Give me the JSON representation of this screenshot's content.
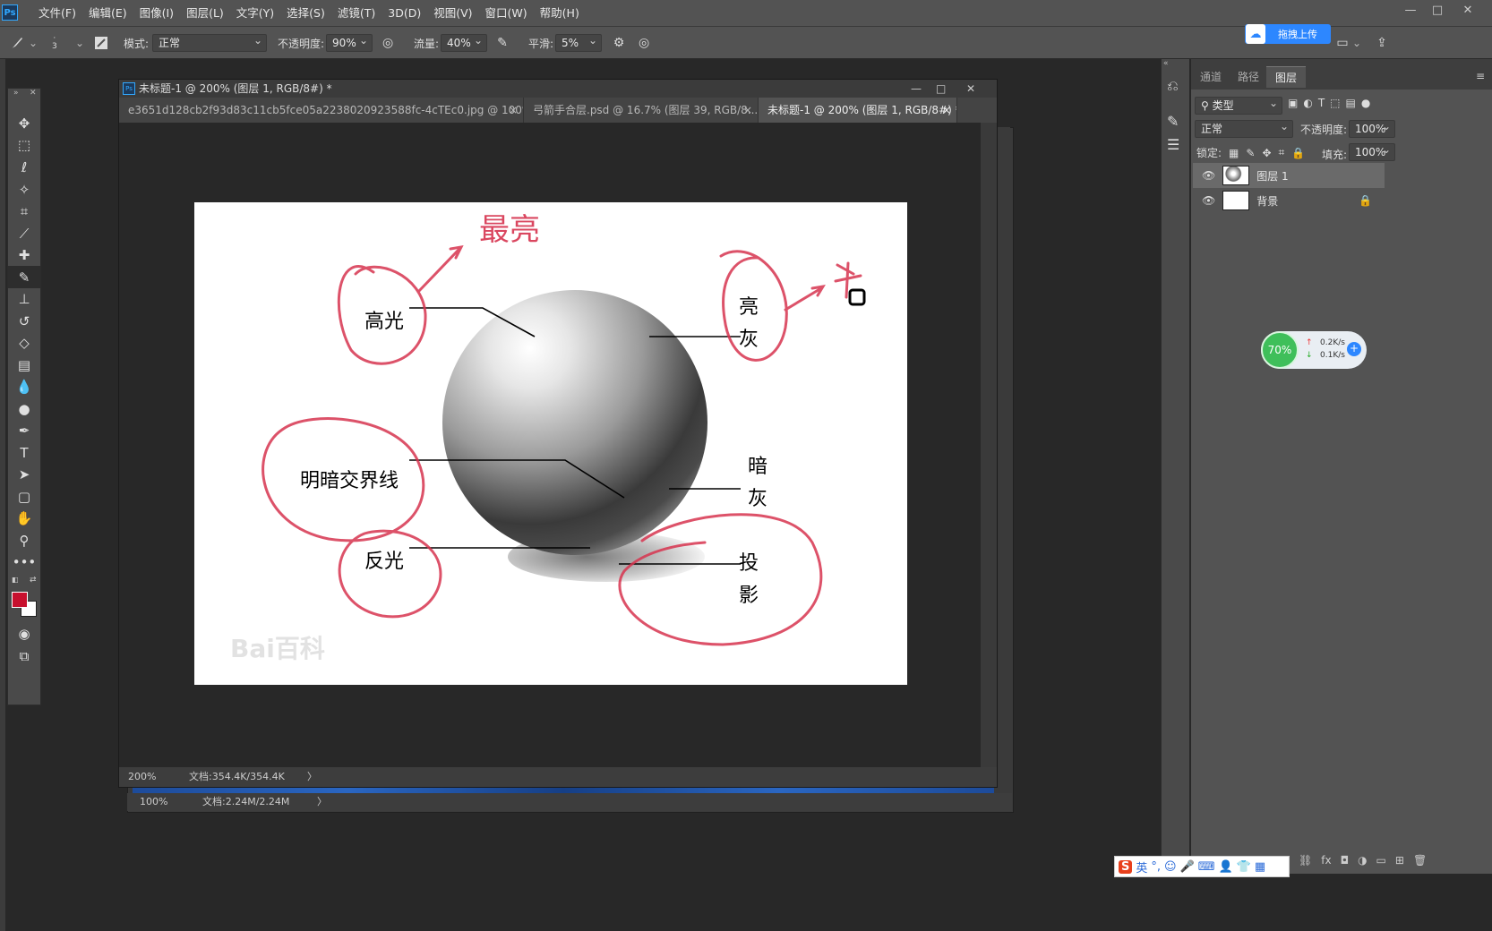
{
  "app": {
    "logo": "Ps"
  },
  "menubar": {
    "items": [
      "文件(F)",
      "编辑(E)",
      "图像(I)",
      "图层(L)",
      "文字(Y)",
      "选择(S)",
      "滤镜(T)",
      "3D(D)",
      "视图(V)",
      "窗口(W)",
      "帮助(H)"
    ],
    "window_controls": [
      "—",
      "□",
      "✕"
    ]
  },
  "options": {
    "brush_size": "3",
    "mode_label": "模式:",
    "mode_value": "正常",
    "opacity_label": "不透明度:",
    "opacity_value": "90%",
    "flow_label": "流量:",
    "flow_value": "40%",
    "smoothing_label": "平滑:",
    "smoothing_value": "5%"
  },
  "cloud_button": {
    "label": "拖拽上传"
  },
  "document": {
    "title": "未标题-1 @ 200% (图层 1, RGB/8#) *",
    "tabs": [
      {
        "label": "e3651d128cb2f93d83c11cb5fce05a2238020923588fc-4cTEc0.jpg @ 100%(RGB...",
        "active": false
      },
      {
        "label": "弓箭手合层.psd @ 16.7% (图层 39, RGB/8...",
        "active": false
      },
      {
        "label": "未标题-1 @ 200% (图层 1, RGB/8#) *",
        "active": true
      }
    ],
    "tab_close": "×",
    "zoom": "200%",
    "doc_size": "文档:354.4K/354.4K",
    "arrow": "〉"
  },
  "back_document": {
    "zoom": "100%",
    "doc_size": "文档:2.24M/2.24M",
    "arrow": "〉"
  },
  "artwork": {
    "labels": {
      "highlight": "高光",
      "light_gray_1": "亮",
      "light_gray_2": "灰",
      "terminator": "明暗交界线",
      "dark_gray_1": "暗",
      "dark_gray_2": "灰",
      "reflected": "反光",
      "shadow_1": "投",
      "shadow_2": "影"
    },
    "handwritten": "最亮",
    "watermark": "Bai百科"
  },
  "panel": {
    "tabs": [
      "通道",
      "路径",
      "图层"
    ],
    "active_tab": "图层",
    "filter_label": "类型",
    "blend_mode": "正常",
    "opacity_label": "不透明度:",
    "opacity_value": "100%",
    "lock_label": "锁定:",
    "fill_label": "填充:",
    "fill_value": "100%",
    "layers": [
      {
        "name": "图层 1",
        "selected": true
      },
      {
        "name": "背景",
        "selected": false
      }
    ]
  },
  "net_widget": {
    "percent": "70%",
    "up": "0.2K/s",
    "down": "0.1K/s"
  },
  "ime": {
    "lang": "英"
  },
  "colors": {
    "foreground": "#c8102e",
    "background": "#ffffff",
    "annotation": "#d7344f",
    "accent": "#31a8ff"
  }
}
